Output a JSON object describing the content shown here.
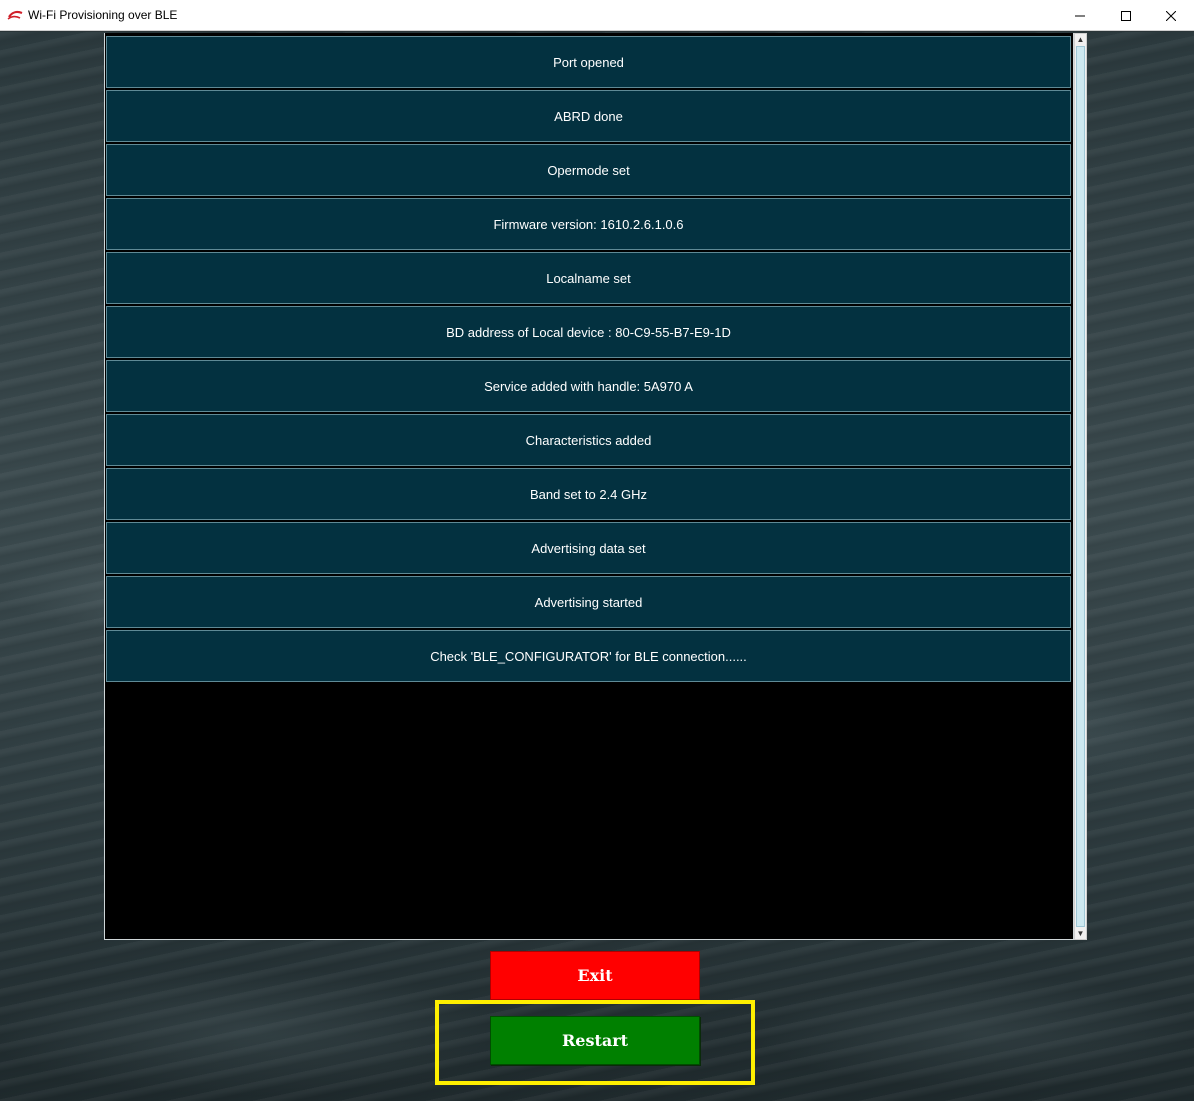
{
  "window": {
    "title": "Wi-Fi Provisioning over BLE",
    "controls": [
      "minimize",
      "maximize",
      "close"
    ]
  },
  "log": {
    "entries": [
      "Port opened",
      "ABRD done",
      "Opermode set",
      "Firmware version: 1610.2.6.1.0.6",
      "Localname set",
      "BD address of Local device :  80-C9-55-B7-E9-1D",
      "Service added with handle: 5A970 A",
      "Characteristics added",
      "Band set to 2.4 GHz",
      "Advertising data set",
      "Advertising started",
      "Check 'BLE_CONFIGURATOR' for BLE connection......"
    ]
  },
  "buttons": {
    "exit_label": "Exit",
    "restart_label": "Restart"
  },
  "colors": {
    "row_bg": "#033140",
    "exit": "#ff0000",
    "restart": "#008000",
    "highlight": "#ffef00"
  }
}
